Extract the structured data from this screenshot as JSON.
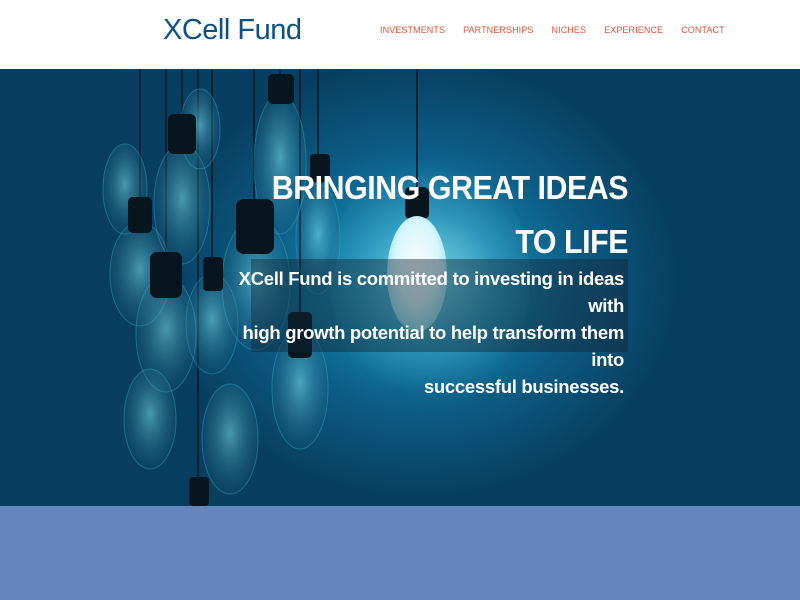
{
  "header": {
    "logo": "XCell Fund",
    "nav": [
      {
        "label": "INVESTMENTS"
      },
      {
        "label": "PARTNERSHIPS"
      },
      {
        "label": "NICHES"
      },
      {
        "label": "EXPERIENCE"
      },
      {
        "label": "CONTACT"
      }
    ]
  },
  "hero": {
    "headline_line1": "BRINGING GREAT IDEAS",
    "headline_line2": "TO LIFE",
    "subtext_line1": "XCell Fund is committed to investing in ideas with",
    "subtext_line2": "high growth potential to help transform them into",
    "subtext_line3": "successful businesses."
  },
  "colors": {
    "logo": "#0e4f86",
    "nav_link": "#e0563a",
    "hero_bg": "#0c5c85",
    "lower_band": "#6585bf"
  }
}
